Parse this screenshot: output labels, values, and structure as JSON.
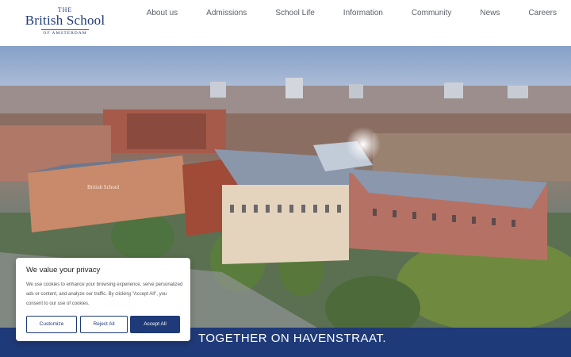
{
  "logo": {
    "the": "THE",
    "name": "British School",
    "sub": "OF AMSTERDAM"
  },
  "nav": {
    "items": [
      {
        "label": "About us"
      },
      {
        "label": "Admissions"
      },
      {
        "label": "School Life"
      },
      {
        "label": "Information"
      },
      {
        "label": "Community"
      },
      {
        "label": "News"
      },
      {
        "label": "Careers"
      }
    ]
  },
  "hero": {
    "building_sign": "British School"
  },
  "banner": {
    "text": "TOGETHER ON HAVENSTRAAT."
  },
  "cookie": {
    "title": "We value your privacy",
    "text": "We use cookies to enhance your browsing experience, serve personalized ads or content, and analyze our traffic. By clicking \"Accept All\", you consent to our use of cookies.",
    "customize": "Customize",
    "reject": "Reject All",
    "accept": "Accept All"
  },
  "colors": {
    "brand": "#1f3a78",
    "accent": "#b02a2a"
  }
}
